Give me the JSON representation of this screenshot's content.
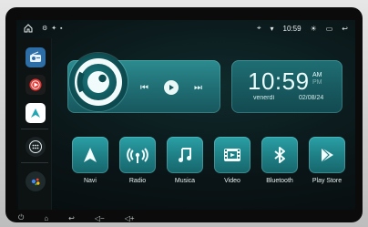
{
  "status_bar": {
    "time": "10:59"
  },
  "sidebar": {
    "items": [
      {
        "name": "Radio app icon"
      },
      {
        "name": "YouTube Music icon"
      },
      {
        "name": "Navigation app icon"
      },
      {
        "name": "App drawer icon"
      },
      {
        "name": "Voice assistant icon"
      }
    ]
  },
  "clock_widget": {
    "time": "10:59",
    "am": "AM",
    "pm": "PM",
    "day": "venerdì",
    "date": "02/08/24"
  },
  "apps": [
    {
      "label": "Navi",
      "icon": "navigation-arrow-icon"
    },
    {
      "label": "Radio",
      "icon": "radio-waves-icon"
    },
    {
      "label": "Musica",
      "icon": "music-note-icon"
    },
    {
      "label": "Video",
      "icon": "film-icon"
    },
    {
      "label": "Bluetooth",
      "icon": "bluetooth-icon"
    },
    {
      "label": "Play Store",
      "icon": "play-store-icon"
    }
  ],
  "colors": {
    "accent": "#1e7e84",
    "accent_light": "#2aa0a6"
  }
}
